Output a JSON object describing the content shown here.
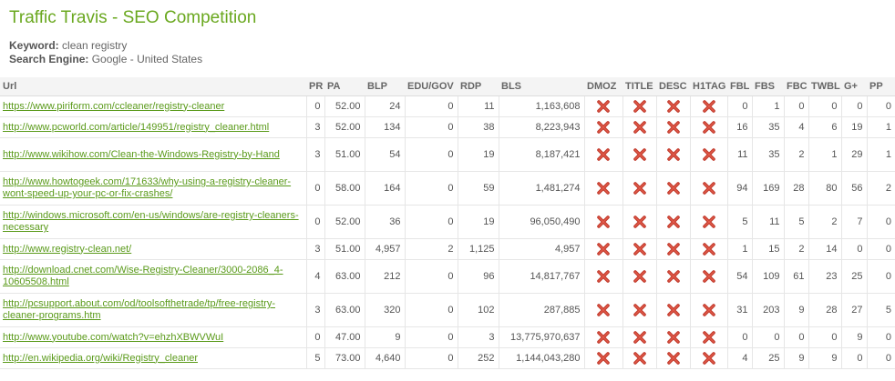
{
  "page": {
    "title": "Traffic Travis - SEO Competition",
    "keyword_label": "Keyword:",
    "keyword_value": "clean registry",
    "engine_label": "Search Engine:",
    "engine_value": "Google - United States"
  },
  "table": {
    "headers": [
      "Url",
      "PR",
      "PA",
      "BLP",
      "EDU/GOV",
      "RDP",
      "BLS",
      "DMOZ",
      "TITLE",
      "DESC",
      "H1TAG",
      "FBL",
      "FBS",
      "FBC",
      "TWBL",
      "G+",
      "PP"
    ],
    "rows": [
      {
        "url": "https://www.piriform.com/ccleaner/registry-cleaner",
        "pr": "0",
        "pa": "52.00",
        "blp": "24",
        "edu": "0",
        "rdp": "11",
        "bls": "1,163,608",
        "fbl": "0",
        "fbs": "1",
        "fbc": "0",
        "twbl": "0",
        "gp": "0",
        "pp": "0"
      },
      {
        "url": "http://www.pcworld.com/article/149951/registry_cleaner.html",
        "pr": "3",
        "pa": "52.00",
        "blp": "134",
        "edu": "0",
        "rdp": "38",
        "bls": "8,223,943",
        "fbl": "16",
        "fbs": "35",
        "fbc": "4",
        "twbl": "6",
        "gp": "19",
        "pp": "1"
      },
      {
        "url": "http://www.wikihow.com/Clean-the-Windows-Registry-by-Hand",
        "pr": "3",
        "pa": "51.00",
        "blp": "54",
        "edu": "0",
        "rdp": "19",
        "bls": "8,187,421",
        "fbl": "11",
        "fbs": "35",
        "fbc": "2",
        "twbl": "1",
        "gp": "29",
        "pp": "1"
      },
      {
        "url": "http://www.howtogeek.com/171633/why-using-a-registry-cleaner-wont-speed-up-your-pc-or-fix-crashes/",
        "pr": "0",
        "pa": "58.00",
        "blp": "164",
        "edu": "0",
        "rdp": "59",
        "bls": "1,481,274",
        "fbl": "94",
        "fbs": "169",
        "fbc": "28",
        "twbl": "80",
        "gp": "56",
        "pp": "2"
      },
      {
        "url": "http://windows.microsoft.com/en-us/windows/are-registry-cleaners-necessary",
        "pr": "0",
        "pa": "52.00",
        "blp": "36",
        "edu": "0",
        "rdp": "19",
        "bls": "96,050,490",
        "fbl": "5",
        "fbs": "11",
        "fbc": "5",
        "twbl": "2",
        "gp": "7",
        "pp": "0"
      },
      {
        "url": "http://www.registry-clean.net/",
        "pr": "3",
        "pa": "51.00",
        "blp": "4,957",
        "edu": "2",
        "rdp": "1,125",
        "bls": "4,957",
        "fbl": "1",
        "fbs": "15",
        "fbc": "2",
        "twbl": "14",
        "gp": "0",
        "pp": "0"
      },
      {
        "url": "http://download.cnet.com/Wise-Registry-Cleaner/3000-2086_4-10605508.html",
        "pr": "4",
        "pa": "63.00",
        "blp": "212",
        "edu": "0",
        "rdp": "96",
        "bls": "14,817,767",
        "fbl": "54",
        "fbs": "109",
        "fbc": "61",
        "twbl": "23",
        "gp": "25",
        "pp": "0"
      },
      {
        "url": "http://pcsupport.about.com/od/toolsofthetrade/tp/free-registry-cleaner-programs.htm",
        "pr": "3",
        "pa": "63.00",
        "blp": "320",
        "edu": "0",
        "rdp": "102",
        "bls": "287,885",
        "fbl": "31",
        "fbs": "203",
        "fbc": "9",
        "twbl": "28",
        "gp": "27",
        "pp": "5"
      },
      {
        "url": "http://www.youtube.com/watch?v=ehzhXBWVWuI",
        "pr": "0",
        "pa": "47.00",
        "blp": "9",
        "edu": "0",
        "rdp": "3",
        "bls": "13,775,970,637",
        "fbl": "0",
        "fbs": "0",
        "fbc": "0",
        "twbl": "0",
        "gp": "9",
        "pp": "0"
      },
      {
        "url": "http://en.wikipedia.org/wiki/Registry_cleaner",
        "pr": "5",
        "pa": "73.00",
        "blp": "4,640",
        "edu": "0",
        "rdp": "252",
        "bls": "1,144,043,280",
        "fbl": "4",
        "fbs": "25",
        "fbc": "9",
        "twbl": "9",
        "gp": "0",
        "pp": "0"
      }
    ]
  },
  "icons": {
    "cross": "cross-icon"
  },
  "colors": {
    "title": "#6aa81f",
    "link": "#5a9a1a",
    "cross": "#c0392b"
  }
}
